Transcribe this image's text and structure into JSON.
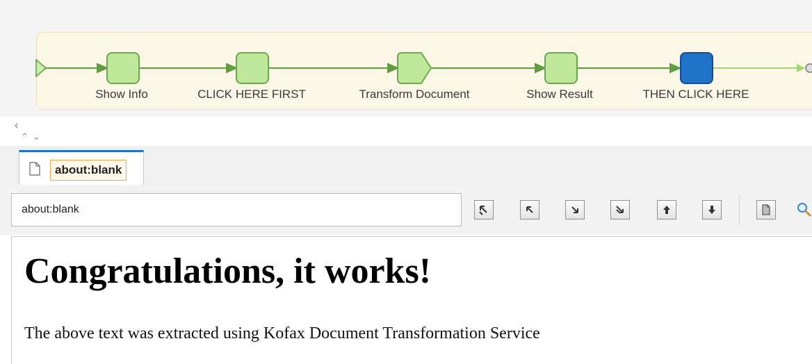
{
  "workflow": {
    "steps": [
      {
        "label": "Show Info"
      },
      {
        "label": "CLICK HERE FIRST"
      },
      {
        "label": "Transform Document"
      },
      {
        "label": "Show Result"
      },
      {
        "label": "THEN CLICK HERE",
        "selected": true
      }
    ],
    "colors": {
      "step_fill": "#bfe89a",
      "step_border": "#6aa84f",
      "selected_fill": "#1f73c8",
      "connector": "#5e9e3c"
    }
  },
  "browser": {
    "tab": {
      "title": "about:blank",
      "icon": "page-icon"
    },
    "address": {
      "value": "about:blank"
    },
    "toolbar": {
      "buttons": [
        "go-first-icon",
        "go-prev-step-icon",
        "go-next-step-icon",
        "go-last-icon",
        "move-up-icon",
        "move-down-icon",
        "page-view-icon",
        "search-icon"
      ]
    }
  },
  "page": {
    "heading": "Congratulations, it works!",
    "body": "The above text was extracted using Kofax Document Transformation Service"
  }
}
